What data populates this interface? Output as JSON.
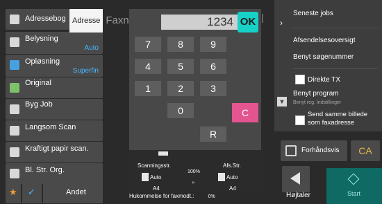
{
  "left_menu": {
    "address_book": "Adressebog",
    "exposure": {
      "label": "Belysning",
      "value": "Auto"
    },
    "resolution": {
      "label": "Opløsning",
      "value": "Superfin"
    },
    "original": "Original",
    "job_build": "Byg Job",
    "slow_scan": "Langsom Scan",
    "thick_paper": "Kraftigt papir scan.",
    "mixed_size": "Bl. Str. Org."
  },
  "tabs": {
    "address": "Adresse",
    "fax": "Faxn"
  },
  "keypad": {
    "display_value": "1234",
    "ok": "OK",
    "keys": [
      "7",
      "8",
      "9",
      "4",
      "5",
      "6",
      "1",
      "2",
      "3",
      "0"
    ],
    "clear": "C",
    "redial": "R"
  },
  "right_panel": {
    "recent_jobs": "Seneste jobs",
    "send_report": "Afsendelsesoversigt",
    "use_search_number": "Benyt søgenummer",
    "direct_tx": "Direkte TX",
    "use_program": "Benyt program",
    "use_program_sub": "Benyt reg. Indstillinger",
    "send_same_image": "Send samme billede som faxadresse"
  },
  "scan_info": {
    "scan_size_label": "Scanningsstr.",
    "scan_size_value": "Auto",
    "scan_size_paper": "A4",
    "ratio": "100%",
    "send_size_label": "Afs.Str.",
    "send_size_value": "Auto",
    "send_size_paper": "A4"
  },
  "memory": {
    "label": "Hukommelse for faxmodt.:",
    "value": "0%"
  },
  "bottom": {
    "other": "Andet",
    "preview": "Forhåndsvis",
    "ca": "CA",
    "speaker": "Højtaler",
    "start": "Start"
  },
  "colors": {
    "ok": "#17d0c6",
    "clear": "#e4548e",
    "accent_text": "#49b8ff",
    "ca": "#e8b84a",
    "start": "#0e6a63"
  }
}
